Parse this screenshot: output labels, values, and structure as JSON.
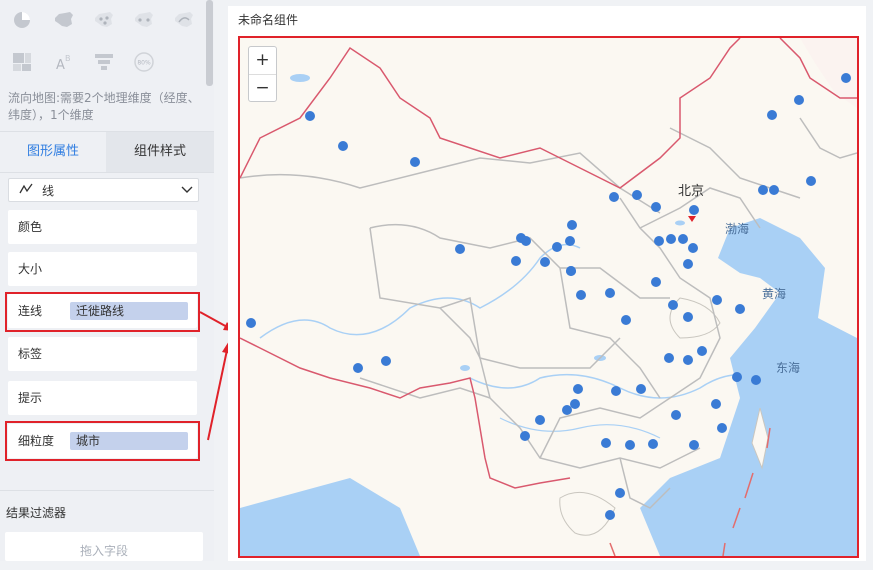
{
  "left_panel": {
    "chart_type_icons": [
      "china-map-pie-icon",
      "china-map-icon",
      "china-map-dots-icon",
      "china-map-dots-2-icon",
      "china-map-line-icon",
      "treemap-icon",
      "word-cloud-icon",
      "funnel-icon",
      "gauge-icon"
    ],
    "gauge_label": "80%",
    "hint": "流向地图:需要2个地理维度（经度、纬度），1个维度",
    "tabs": [
      "图形属性",
      "组件样式"
    ],
    "mark_type": "线",
    "props": {
      "color": "颜色",
      "size": "大小",
      "line": "连线",
      "line_value": "迁徙路线",
      "label": "标签",
      "tooltip": "提示",
      "granularity": "细粒度",
      "granularity_value": "城市"
    },
    "filter_title": "结果过滤器",
    "drop_placeholder": "拖入字段"
  },
  "component": {
    "title": "未命名组件",
    "zoom_in": "+",
    "zoom_out": "−",
    "map_labels": {
      "beijing": "北京",
      "bohai": "渤海",
      "yellow_sea": "黄海",
      "east_sea": "东海"
    }
  },
  "colors": {
    "accent": "#2f7de1",
    "highlight": "#e0222a",
    "pill": "#c4d1ec",
    "city_dot": "#3a7bd5",
    "water": "#a9d0f5",
    "land": "#fbf8f2"
  }
}
